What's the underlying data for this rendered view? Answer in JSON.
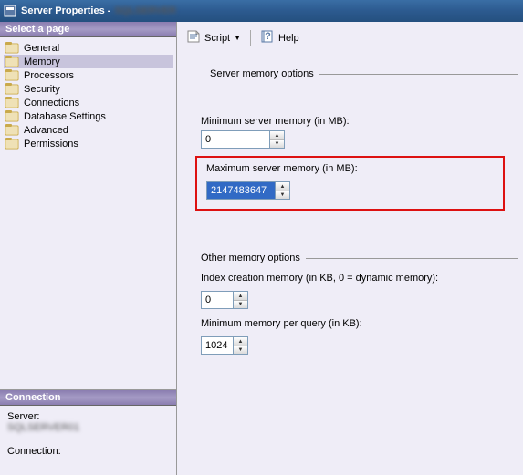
{
  "window": {
    "title": "Server Properties -"
  },
  "sidebar": {
    "header": "Select a page",
    "items": [
      {
        "label": "General"
      },
      {
        "label": "Memory"
      },
      {
        "label": "Processors"
      },
      {
        "label": "Security"
      },
      {
        "label": "Connections"
      },
      {
        "label": "Database Settings"
      },
      {
        "label": "Advanced"
      },
      {
        "label": "Permissions"
      }
    ],
    "selected_index": 1
  },
  "connection": {
    "header": "Connection",
    "server_label": "Server:",
    "server_value": "(hidden)",
    "conn_label": "Connection:"
  },
  "toolbar": {
    "script_label": "Script",
    "help_label": "Help"
  },
  "memory": {
    "group1_title": "Server memory options",
    "min_label": "Minimum server memory (in MB):",
    "min_value": "0",
    "max_label": "Maximum server memory (in MB):",
    "max_value": "2147483647",
    "group2_title": "Other memory options",
    "index_label": "Index creation memory (in KB, 0 = dynamic memory):",
    "index_value": "0",
    "minquery_label": "Minimum memory per query (in KB):",
    "minquery_value": "1024"
  }
}
